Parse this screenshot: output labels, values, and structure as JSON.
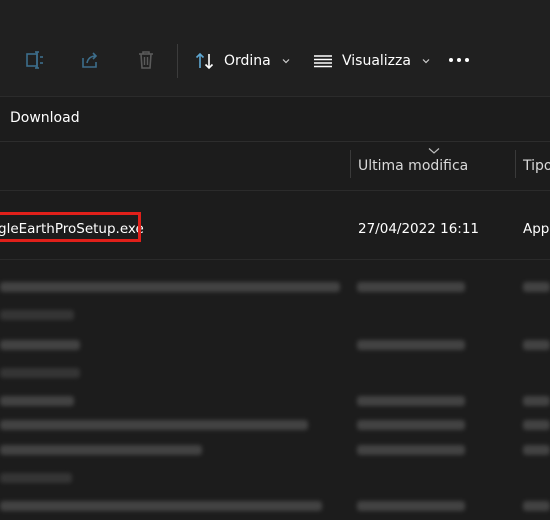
{
  "toolbar": {
    "sort_label": "Ordina",
    "view_label": "Visualizza",
    "icons": [
      "share-left-icon",
      "share-icon",
      "delete-icon",
      "sort-icon",
      "view-icon",
      "more-icon"
    ]
  },
  "address": {
    "crumb": "Download"
  },
  "columns": {
    "modified": "Ultima modifica",
    "type": "Tipo"
  },
  "file": {
    "name": "gleEarthProSetup.exe",
    "modified": "27/04/2022 16:11",
    "type": "App"
  },
  "colors": {
    "background": "#1c1c1c",
    "toolbar": "#202020",
    "accent_icon": "#5fa8d3",
    "highlight": "#e0201a"
  }
}
